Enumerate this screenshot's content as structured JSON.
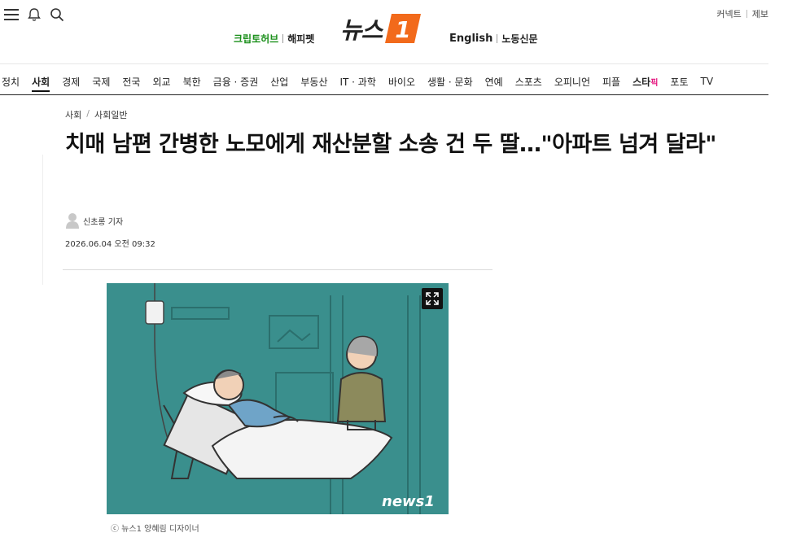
{
  "header": {
    "menu_icon": "hamburger-icon",
    "alarm_icon": "bell-icon",
    "search_icon": "search-icon",
    "right_links": [
      "커넥트",
      "제보"
    ],
    "sub_left": [
      "크립토허브",
      "해피펫"
    ],
    "logo_text": "뉴스",
    "logo_number": "1",
    "sub_right": [
      "English",
      "노동신문"
    ]
  },
  "nav": {
    "items": [
      "정치",
      "사회",
      "경제",
      "국제",
      "전국",
      "외교",
      "북한",
      "금융 · 증권",
      "산업",
      "부동산",
      "IT · 과학",
      "바이오",
      "생활 · 문화",
      "연예",
      "스포츠",
      "오피니언",
      "피플"
    ],
    "star_label": "스타",
    "star_suffix": "픽",
    "tail_items": [
      "포토",
      "TV"
    ],
    "active": "사회"
  },
  "article": {
    "breadcrumb": [
      "사회",
      "사회일반"
    ],
    "title": "치매 남편 간병한 노모에게 재산분할 소송 건 두 딸…\"아파트 넘겨 달라\"",
    "author": "신초롱 기자",
    "date": "2026.06.04 오전 09:32",
    "image_watermark": "news1",
    "caption": "ⓒ 뉴스1 양혜림 디자이너"
  },
  "colors": {
    "accent_orange": "#f26a1b",
    "crypto_green": "#1a8f1a",
    "star_pink": "#e5167f",
    "illustration_bg": "#3a8f8d"
  }
}
